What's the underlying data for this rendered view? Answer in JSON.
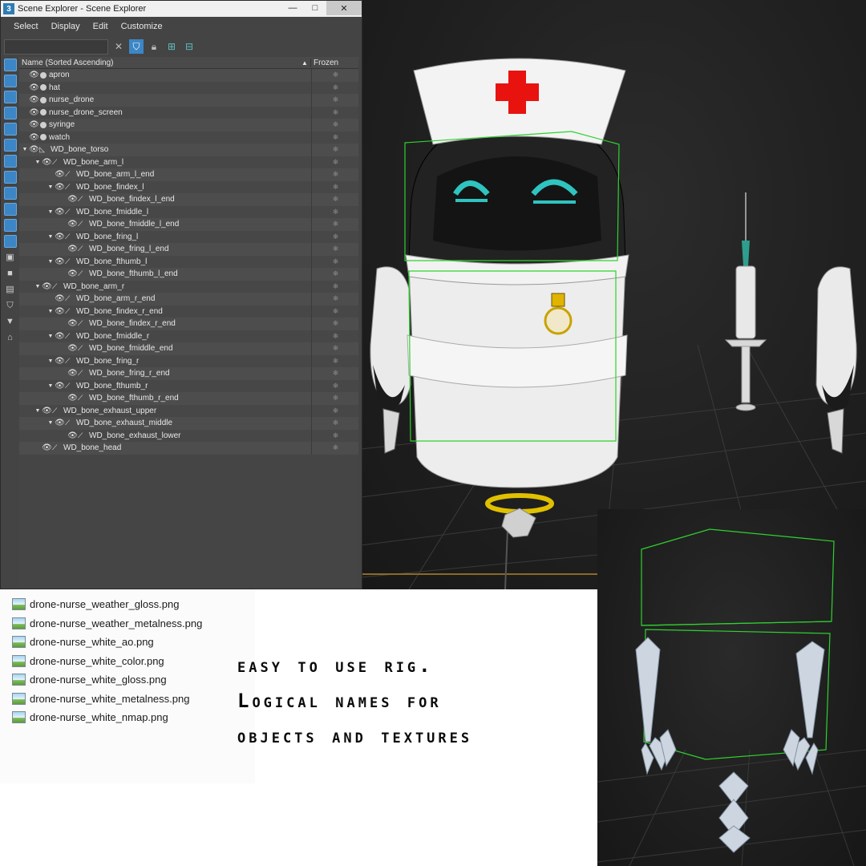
{
  "window": {
    "app_badge": "3",
    "title": "Scene Explorer - Scene Explorer",
    "buttons": {
      "minimize": "—",
      "maximize": "□",
      "close": "✕"
    }
  },
  "menu": [
    "Select",
    "Display",
    "Edit",
    "Customize"
  ],
  "toolbar": {
    "search_value": "",
    "icons": [
      "clear-search-icon",
      "filter-icon",
      "lock-icon",
      "hierarchy-icon",
      "hierarchy-alt-icon"
    ]
  },
  "columns": {
    "name": "Name (Sorted Ascending)",
    "sort_glyph": "▲",
    "frozen": "Frozen"
  },
  "tree": [
    {
      "label": "apron",
      "depth": 0,
      "expander": "",
      "kind": "object"
    },
    {
      "label": "hat",
      "depth": 0,
      "expander": "",
      "kind": "object"
    },
    {
      "label": "nurse_drone",
      "depth": 0,
      "expander": "",
      "kind": "object"
    },
    {
      "label": "nurse_drone_screen",
      "depth": 0,
      "expander": "",
      "kind": "object"
    },
    {
      "label": "syringe",
      "depth": 0,
      "expander": "",
      "kind": "object"
    },
    {
      "label": "watch",
      "depth": 0,
      "expander": "",
      "kind": "object"
    },
    {
      "label": "WD_bone_torso",
      "depth": 0,
      "expander": "▼",
      "kind": "bone"
    },
    {
      "label": "WD_bone_arm_l",
      "depth": 1,
      "expander": "▼",
      "kind": "bone"
    },
    {
      "label": "WD_bone_arm_l_end",
      "depth": 2,
      "expander": "",
      "kind": "bone"
    },
    {
      "label": "WD_bone_findex_l",
      "depth": 2,
      "expander": "▼",
      "kind": "bone"
    },
    {
      "label": "WD_bone_findex_l_end",
      "depth": 3,
      "expander": "",
      "kind": "bone"
    },
    {
      "label": "WD_bone_fmiddle_l",
      "depth": 2,
      "expander": "▼",
      "kind": "bone"
    },
    {
      "label": "WD_bone_fmiddle_l_end",
      "depth": 3,
      "expander": "",
      "kind": "bone"
    },
    {
      "label": "WD_bone_fring_l",
      "depth": 2,
      "expander": "▼",
      "kind": "bone"
    },
    {
      "label": "WD_bone_fring_l_end",
      "depth": 3,
      "expander": "",
      "kind": "bone"
    },
    {
      "label": "WD_bone_fthumb_l",
      "depth": 2,
      "expander": "▼",
      "kind": "bone"
    },
    {
      "label": "WD_bone_fthumb_l_end",
      "depth": 3,
      "expander": "",
      "kind": "bone"
    },
    {
      "label": "WD_bone_arm_r",
      "depth": 1,
      "expander": "▼",
      "kind": "bone"
    },
    {
      "label": "WD_bone_arm_r_end",
      "depth": 2,
      "expander": "",
      "kind": "bone"
    },
    {
      "label": "WD_bone_findex_r_end",
      "depth": 2,
      "expander": "▼",
      "kind": "bone"
    },
    {
      "label": "WD_bone_findex_r_end",
      "depth": 3,
      "expander": "",
      "kind": "bone"
    },
    {
      "label": "WD_bone_fmiddle_r",
      "depth": 2,
      "expander": "▼",
      "kind": "bone"
    },
    {
      "label": "WD_bone_fmiddle_end",
      "depth": 3,
      "expander": "",
      "kind": "bone"
    },
    {
      "label": "WD_bone_fring_r",
      "depth": 2,
      "expander": "▼",
      "kind": "bone"
    },
    {
      "label": "WD_bone_fring_r_end",
      "depth": 3,
      "expander": "",
      "kind": "bone"
    },
    {
      "label": "WD_bone_fthumb_r",
      "depth": 2,
      "expander": "▼",
      "kind": "bone"
    },
    {
      "label": "WD_bone_fthumb_r_end",
      "depth": 3,
      "expander": "",
      "kind": "bone"
    },
    {
      "label": "WD_bone_exhaust_upper",
      "depth": 1,
      "expander": "▼",
      "kind": "bone"
    },
    {
      "label": "WD_bone_exhaust_middle",
      "depth": 2,
      "expander": "▼",
      "kind": "bone"
    },
    {
      "label": "WD_bone_exhaust_lower",
      "depth": 3,
      "expander": "",
      "kind": "bone"
    },
    {
      "label": "WD_bone_head",
      "depth": 1,
      "expander": "",
      "kind": "bone"
    }
  ],
  "frozen_glyph": "❄",
  "files": [
    "drone-nurse_weather_gloss.png",
    "drone-nurse_weather_metalness.png",
    "drone-nurse_white_ao.png",
    "drone-nurse_white_color.png",
    "drone-nurse_white_gloss.png",
    "drone-nurse_white_metalness.png",
    "drone-nurse_white_nmap.png"
  ],
  "caption": {
    "line1": "easy to use rig.",
    "line2": "Logical names for",
    "line3": "objects and textures"
  },
  "colors": {
    "selection_box": "#2fd12f",
    "cross": "#e8130f",
    "screen_eyes": "#2fc4c0",
    "accent_blue": "#3d86c6"
  }
}
